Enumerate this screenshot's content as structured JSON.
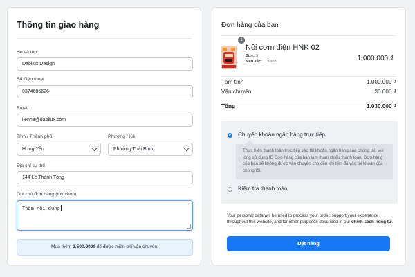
{
  "shipping": {
    "title": "Thông tin giao hàng",
    "fullname": {
      "label": "Họ và tên",
      "value": "Dabilux Design"
    },
    "phone": {
      "label": "Số điện thoại",
      "value": "0374686626"
    },
    "email": {
      "label": "Email",
      "value": "lienhe@dabilux.com"
    },
    "province": {
      "label": "Tỉnh / Thành phố",
      "value": "Hưng Yên"
    },
    "ward": {
      "label": "Phường / Xã",
      "value": "Phường Thái Bình"
    },
    "address": {
      "label": "Địa chỉ cụ thể",
      "value": "144 Lê Thánh Tông"
    },
    "note": {
      "label": "Ghi chú đơn hàng (tùy chọn)",
      "value": "Thêm nội dung"
    },
    "free_ship": {
      "prefix": "Mua thêm",
      "amount": "3.500.000₫",
      "suffix": "để được miễn phí vận chuyển!"
    }
  },
  "order": {
    "title": "Đơn hàng của bạn",
    "item": {
      "qty": "1",
      "name": "Nồi cơm điện HNK 02",
      "size_label": "Size:",
      "size_value": "S",
      "color_label": "Màu sắc:",
      "color_value": "Xanh",
      "price": "1.000.000 ₫"
    },
    "subtotal": {
      "label": "Tạm tính",
      "value": "1.000.000 ₫"
    },
    "shipping": {
      "label": "Vận chuyển",
      "value": "30.000 ₫"
    },
    "total": {
      "label": "Tổng",
      "value": "1.030.000 ₫"
    },
    "payment": {
      "bank_label": "Chuyển khoản ngân hàng trực tiếp",
      "bank_desc": "Thực hiện thanh toán trực tiếp vào tài khoản ngân hàng của chúng tôi. Vui lòng sử dụng ID Đơn hàng của bạn làm tham chiếu thanh toán. Đơn hàng của bạn sẽ không được vận chuyển cho đến khi tiền đã vào tài khoản của chúng tôi.",
      "check_label": "Kiểm tra thanh toán",
      "selected": "bank"
    },
    "privacy": {
      "text": "Your personal data will be used to process your order, support your experience throughout this website, and for other purposes described in our",
      "link": "chính sách riêng tư",
      "end": "."
    },
    "submit_label": "Đặt hàng"
  },
  "colors": {
    "accent": "#1877f2",
    "focus": "#5b9ae8",
    "note_bg": "#e7f2fd"
  },
  "icons": {
    "select_caret": "chevron-down-icon"
  }
}
